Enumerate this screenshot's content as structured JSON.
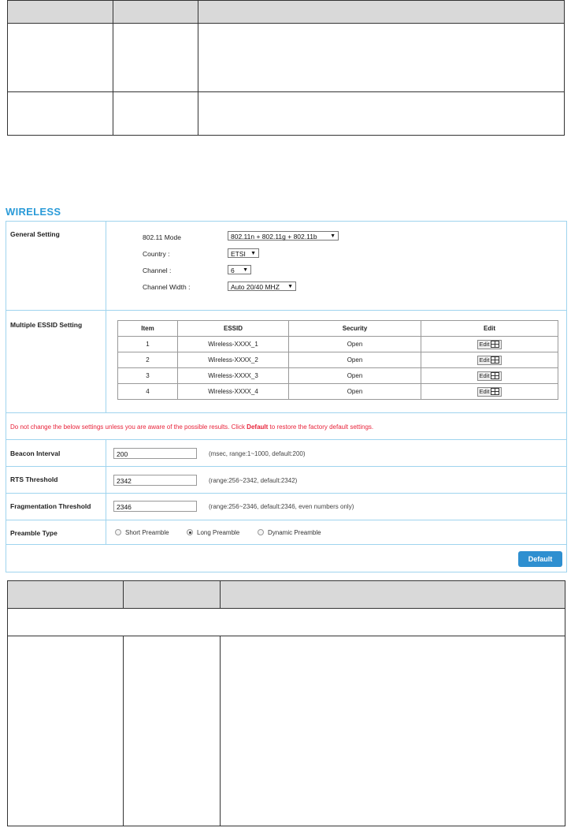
{
  "wireless": {
    "title": "WIRELESS",
    "general": {
      "label": "General Setting",
      "fields": [
        {
          "label": "802.11 Mode",
          "value": "802.11n + 802.11g + 802.11b"
        },
        {
          "label": "Country :",
          "value": "ETSI"
        },
        {
          "label": "Channel :",
          "value": "6"
        },
        {
          "label": "Channel Width :",
          "value": "Auto 20/40 MHZ"
        }
      ]
    },
    "essid": {
      "label": "Multiple ESSID Setting",
      "headers": [
        "Item",
        "ESSID",
        "Security",
        "Edit"
      ],
      "rows": [
        {
          "item": "1",
          "essid": "Wireless-XXXX_1",
          "security": "Open",
          "edit": "Edit"
        },
        {
          "item": "2",
          "essid": "Wireless-XXXX_2",
          "security": "Open",
          "edit": "Edit"
        },
        {
          "item": "3",
          "essid": "Wireless-XXXX_3",
          "security": "Open",
          "edit": "Edit"
        },
        {
          "item": "4",
          "essid": "Wireless-XXXX_4",
          "security": "Open",
          "edit": "Edit"
        }
      ]
    },
    "warning": {
      "pre": "Do not change the below settings unless you are aware of the possible results. Click ",
      "bold": "Default",
      "post": " to restore the factory default settings."
    },
    "beacon": {
      "label": "Beacon Interval",
      "value": "200",
      "hint": "(msec, range:1~1000, default:200)"
    },
    "rts": {
      "label": "RTS Threshold",
      "value": "2342",
      "hint": "(range:256~2342, default:2342)"
    },
    "frag": {
      "label": "Fragmentation Threshold",
      "value": "2346",
      "hint": "(range:256~2346, default:2346, even numbers only)"
    },
    "preamble": {
      "label": "Preamble Type",
      "options": [
        "Short Preamble",
        "Long Preamble",
        "Dynamic Preamble"
      ],
      "selected": "Long Preamble"
    },
    "default_button": "Default"
  },
  "colors": {
    "accent": "#2b9bd8",
    "button": "#2e8fd0",
    "warning": "#e8233a",
    "header_fill": "#d9d9d9"
  }
}
